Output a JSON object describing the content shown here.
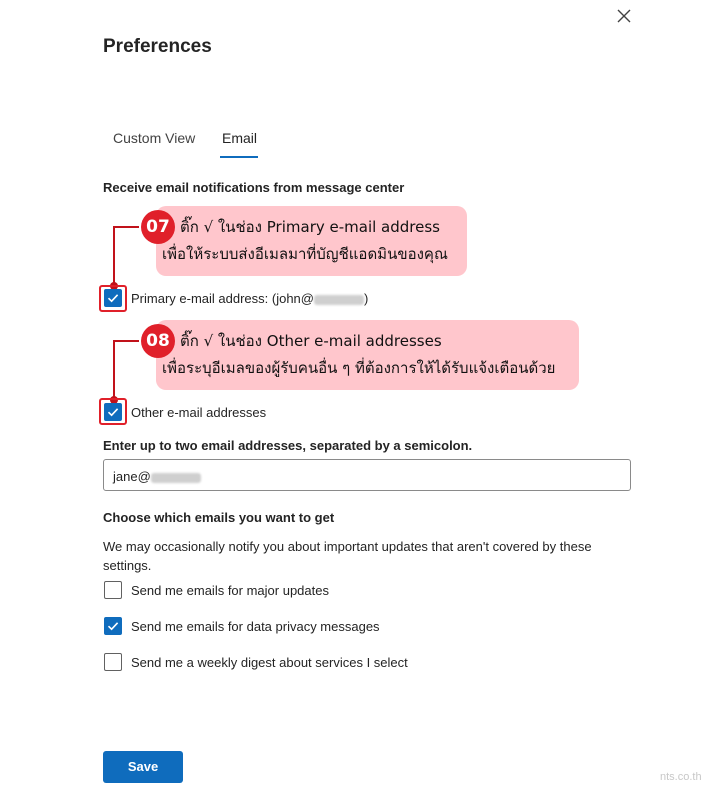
{
  "dialog": {
    "title": "Preferences",
    "close_icon": "close-icon"
  },
  "tabs": [
    {
      "label": "Custom View",
      "selected": false
    },
    {
      "label": "Email",
      "selected": true
    }
  ],
  "notifications": {
    "heading": "Receive email notifications from message center",
    "primary": {
      "label_prefix": "Primary e-mail address: (john@",
      "label_suffix": ")",
      "checked": true
    },
    "other": {
      "label": "Other e-mail addresses",
      "checked": true
    }
  },
  "callouts": [
    {
      "badge": "07",
      "line1": "ติ๊ก √ ในช่อง Primary e-mail address",
      "line2": "เพื่อให้ระบบส่งอีเมลมาที่บัญชีแอดมินของคุณ"
    },
    {
      "badge": "08",
      "line1": "ติ๊ก √ ในช่อง Other e-mail addresses",
      "line2": "เพื่อระบุอีเมลของผู้รับคนอื่น ๆ ที่ต้องการให้ได้รับแจ้งเตือนด้วย"
    }
  ],
  "other_addresses": {
    "heading": "Enter up to two email addresses, separated by a semicolon.",
    "value_prefix": "jane@"
  },
  "emails": {
    "heading": "Choose which emails you want to get",
    "description": "We may occasionally notify you about important updates that aren't covered by these settings.",
    "options": [
      {
        "label": "Send me emails for major updates",
        "checked": false
      },
      {
        "label": "Send me emails for data privacy messages",
        "checked": true
      },
      {
        "label": "Send me a weekly digest about services I select",
        "checked": false
      }
    ]
  },
  "save_label": "Save",
  "watermark": "nts.co.th",
  "colors": {
    "accent": "#0f6cbd",
    "annotation_red": "#e0202a",
    "callout_bg": "#ffc6cc"
  }
}
